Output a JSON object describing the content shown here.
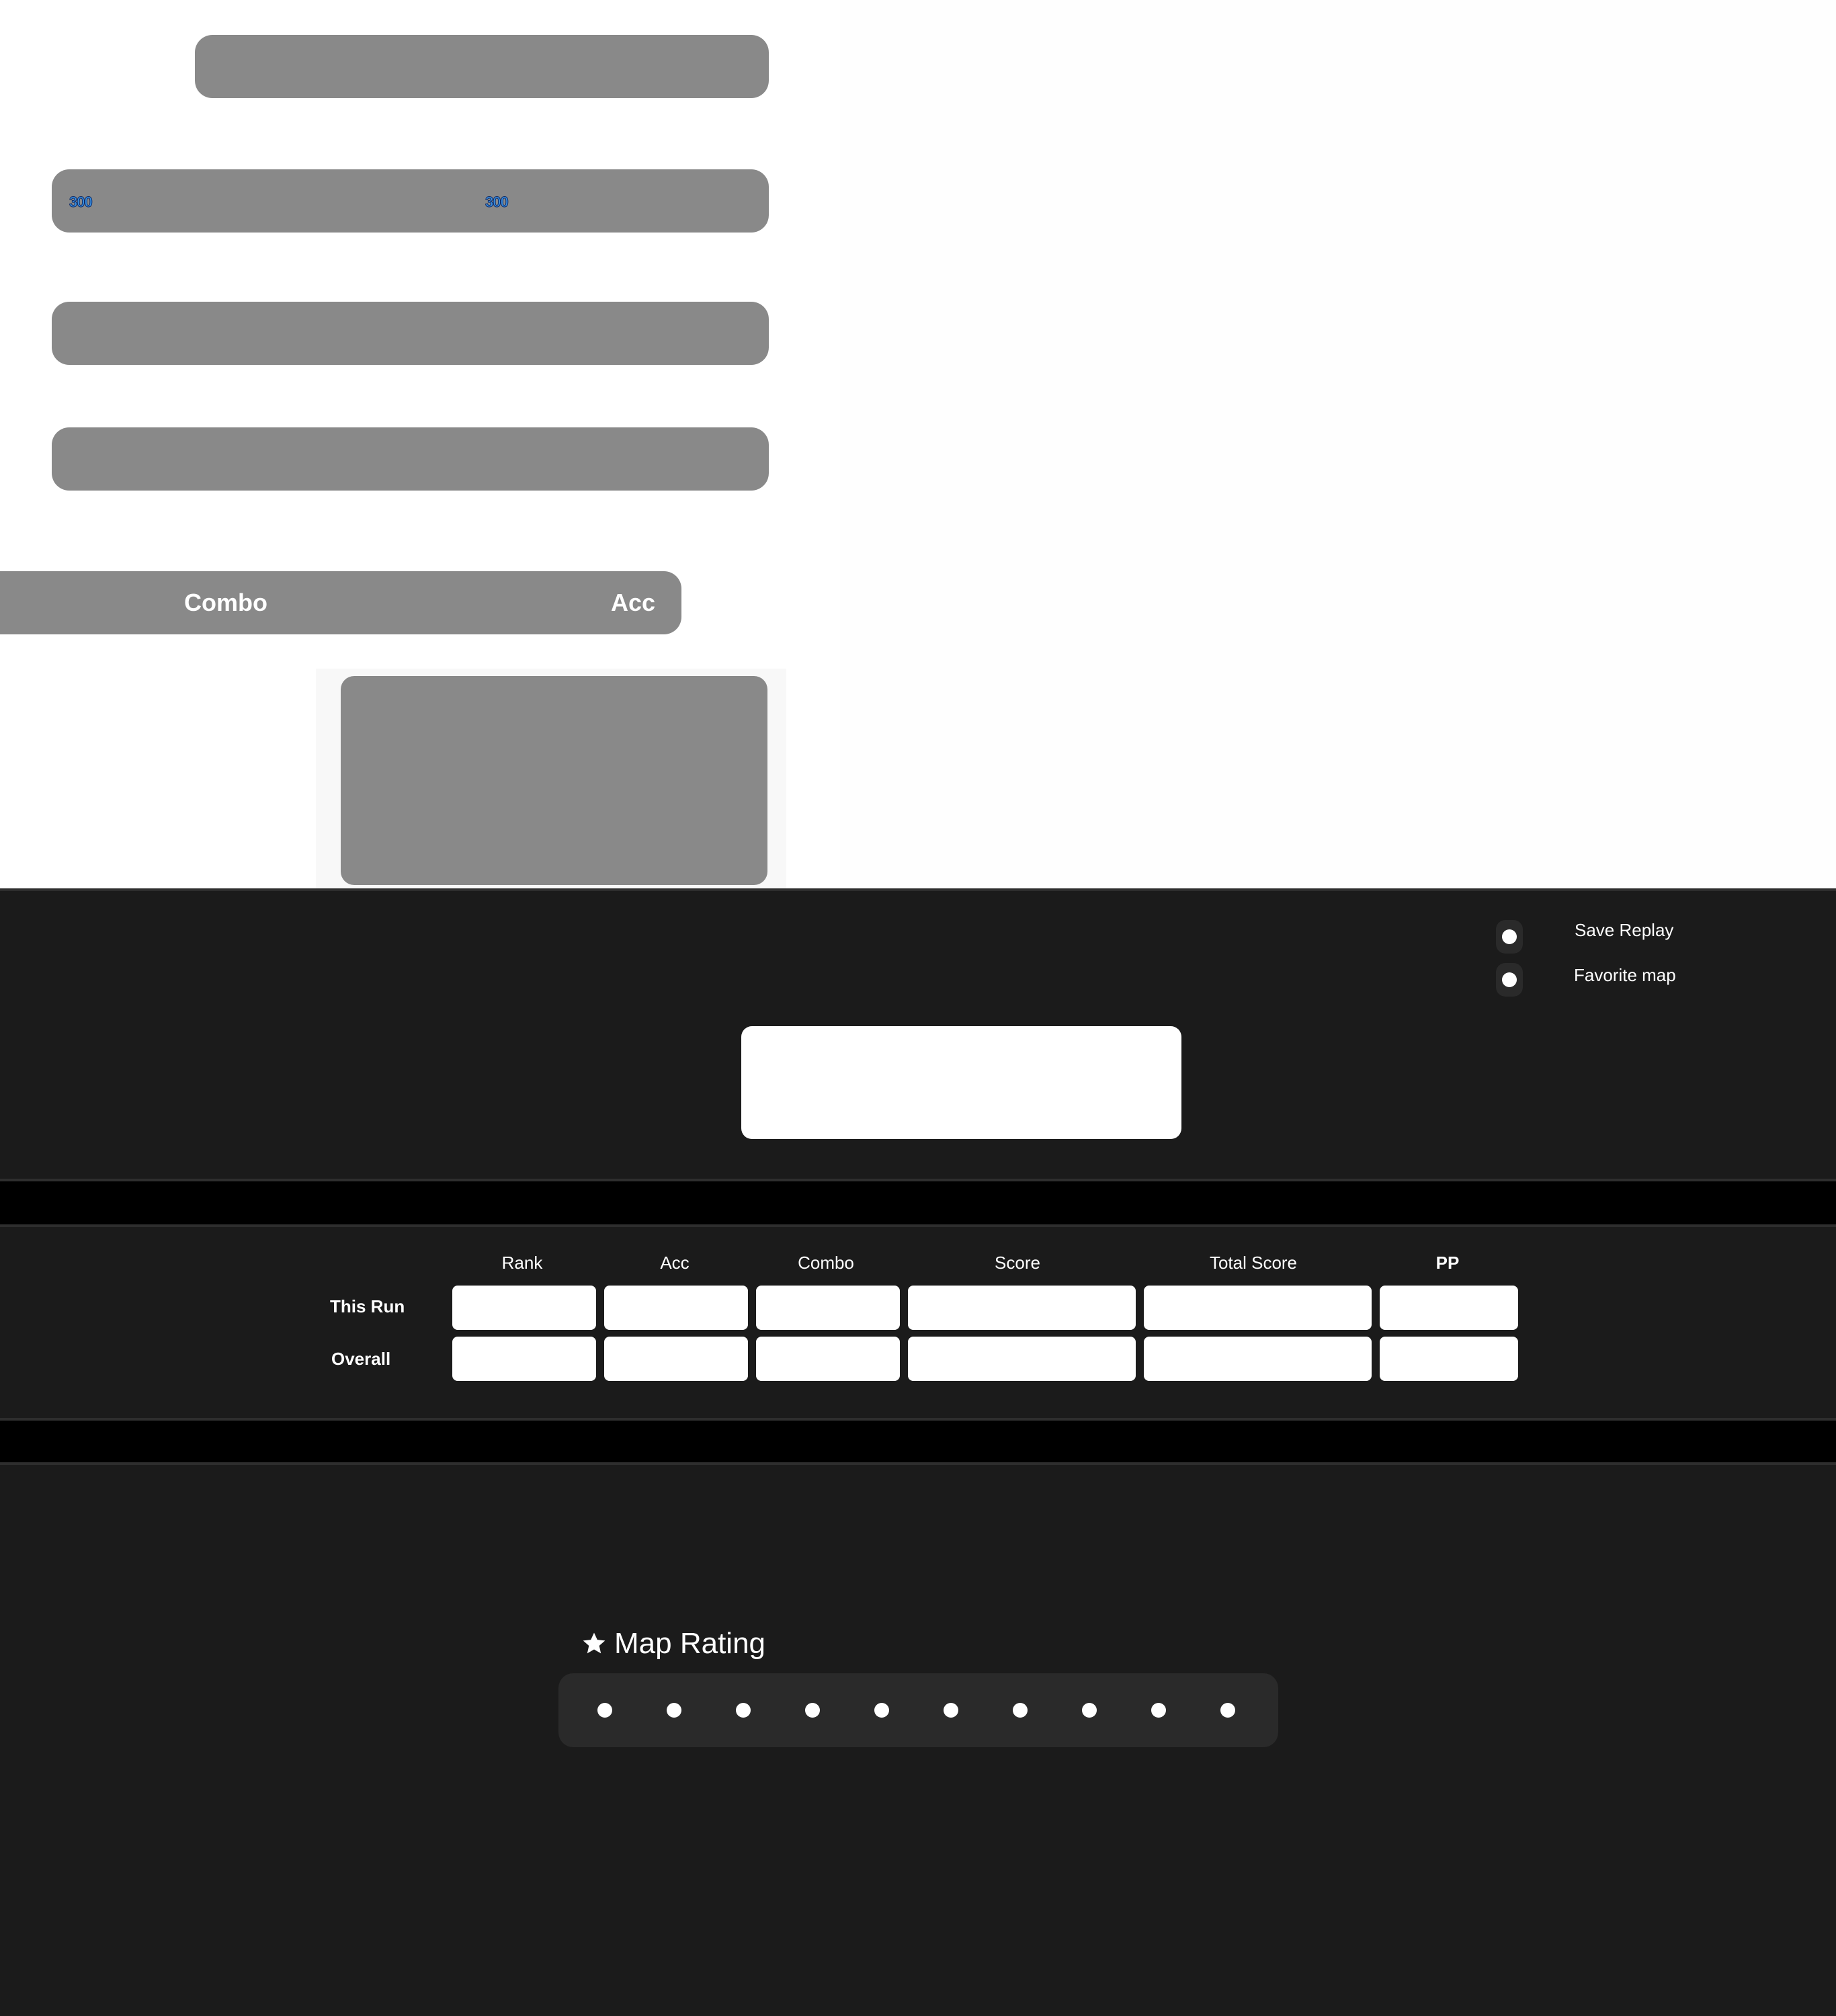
{
  "hit_bars": {
    "judge_left": "300",
    "judge_right": "300"
  },
  "stats_bar": {
    "combo_label": "Combo",
    "acc_label": "Acc"
  },
  "options": {
    "save_replay_label": "Save Replay",
    "favorite_map_label": "Favorite map"
  },
  "results_table": {
    "columns": [
      "Rank",
      "Acc",
      "Combo",
      "Score",
      "Total Score",
      "PP"
    ],
    "rows": [
      "This Run",
      "Overall"
    ]
  },
  "map_rating": {
    "title": "Map Rating",
    "icon": "star-icon",
    "dot_count": 10
  },
  "colors": {
    "dark_bg": "#1b1b1b",
    "bar_gray": "#898989",
    "judge_blue": "#3a8fe0"
  }
}
